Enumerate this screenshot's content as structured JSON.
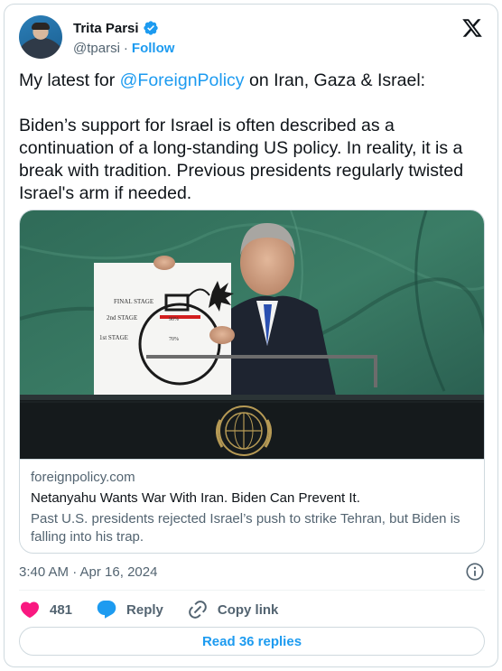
{
  "author": {
    "name": "Trita Parsi",
    "handle": "@tparsi",
    "separator": "·",
    "follow_label": "Follow"
  },
  "tweet": {
    "line1_prefix": "My latest for ",
    "mention": "@ForeignPolicy",
    "line1_suffix": " on Iran, Gaza & Israel:",
    "paragraph2": "Biden’s support for Israel is often described as a continuation of a long-standing US policy. In reality, it is a break with tradition. Previous presidents regularly twisted Israel's arm if needed."
  },
  "link_card": {
    "domain": "foreignpolicy.com",
    "title": "Netanyahu Wants War With Iran. Biden Can Prevent It.",
    "description": "Past U.S. presidents rejected Israel’s push to strike Tehran, but Biden is falling into his trap.",
    "image_labels": {
      "final_stage": "FINAL STAGE",
      "second_stage": "2nd STAGE",
      "first_stage": "1st STAGE",
      "pct_90": "90%",
      "pct_70": "70%"
    }
  },
  "timestamp": "3:40 AM · Apr 16, 2024",
  "actions": {
    "like_count": "481",
    "reply_label": "Reply",
    "copy_label": "Copy link"
  },
  "read_replies_label": "Read 36 replies",
  "colors": {
    "accent": "#1d9bf0",
    "like": "#f91880",
    "muted": "#536471",
    "border": "#cfd9de"
  },
  "icons": [
    "verified-badge-icon",
    "x-logo-icon",
    "info-icon",
    "heart-icon",
    "reply-bubble-icon",
    "link-icon"
  ]
}
